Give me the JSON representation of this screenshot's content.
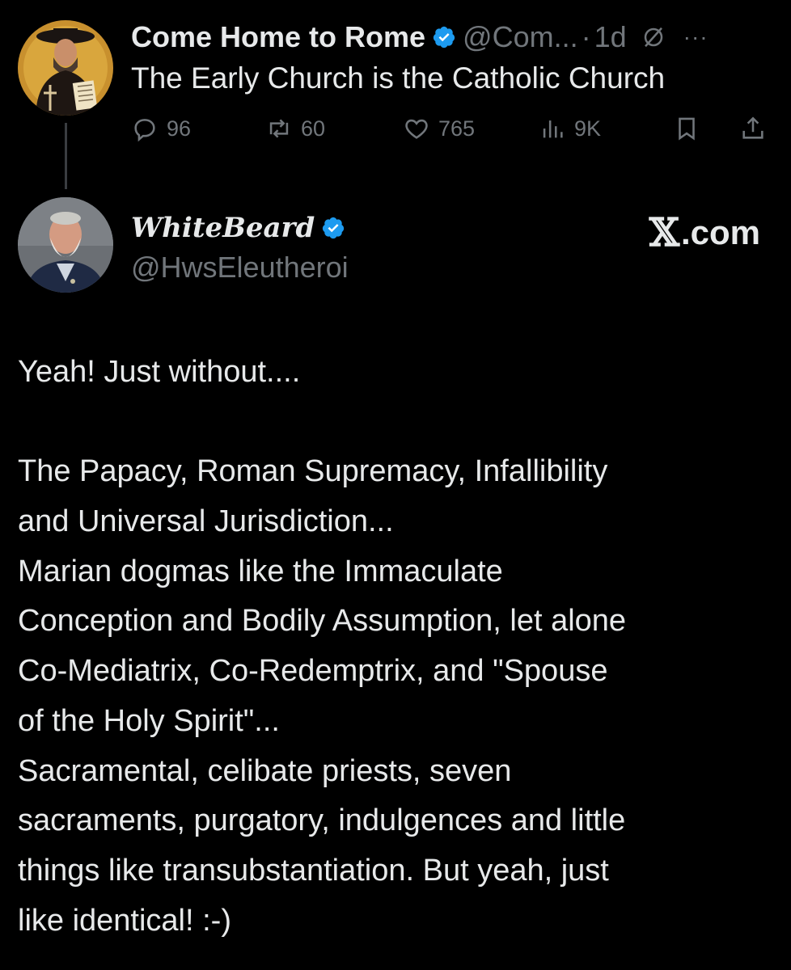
{
  "tweet1": {
    "author_name": "Come Home to Rome",
    "handle": "@Com...",
    "separator": "·",
    "time": "1d",
    "more": "···",
    "text": "The Early Church is the Catholic Church",
    "replies": "96",
    "retweets": "60",
    "likes": "765",
    "views": "9K"
  },
  "tweet2": {
    "author_name": "WhiteBeard",
    "handle": "@HwsEleutheroi",
    "watermark": {
      "logo": "𝕏",
      "text": ".com"
    },
    "lines": [
      "Yeah!  Just without....",
      "",
      "The Papacy, Roman Supremacy, Infallibility",
      "and Universal Jurisdiction...",
      "Marian dogmas like the Immaculate",
      "Conception and Bodily Assumption, let alone",
      "Co-Mediatrix, Co-Redemptrix, and \"Spouse",
      "of the Holy Spirit\"...",
      "Sacramental, celibate priests, seven",
      "sacraments, purgatory, indulgences and little",
      "things like transubstantiation.  But yeah, just",
      "like identical!   :-)"
    ]
  },
  "colors": {
    "background": "#000000",
    "text": "#e7e9ea",
    "muted": "#71767b",
    "verified": "#1d9bf0"
  },
  "icons": [
    "verified-badge-icon",
    "muted-icon",
    "more-icon",
    "reply-icon",
    "retweet-icon",
    "like-icon",
    "views-icon",
    "bookmark-icon",
    "share-icon"
  ]
}
